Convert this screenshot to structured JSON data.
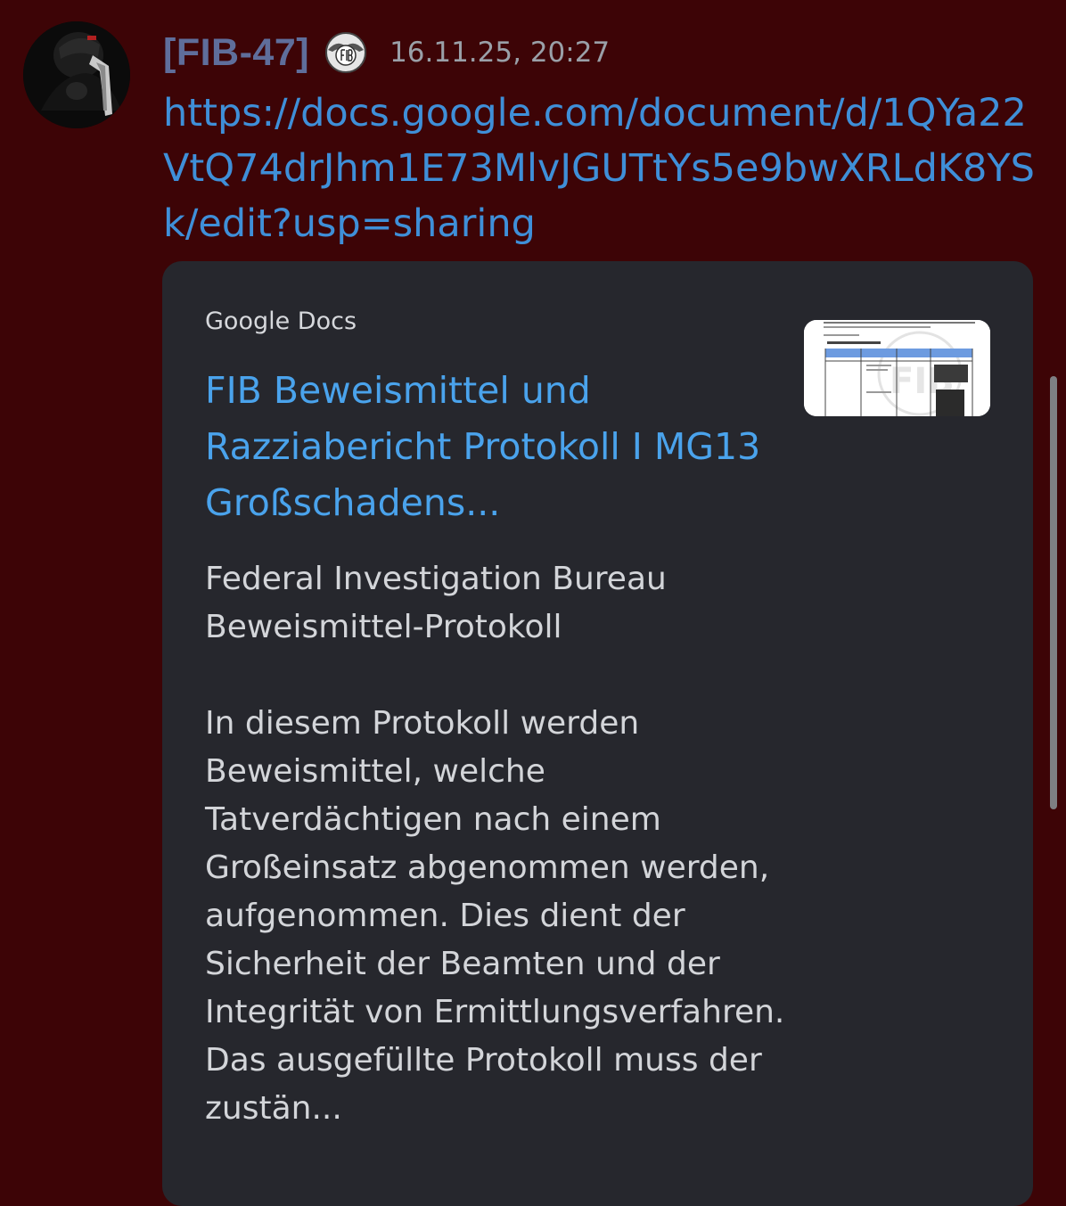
{
  "message": {
    "author": "[FIB-47]",
    "timestamp": "16.11.25, 20:27",
    "link": "https://docs.google.com/document/d/1QYa22VtQ74drJhm1E73MlvJGUTtYs5e9bwXRLdK8YSk/edit?usp=sharing"
  },
  "embed": {
    "provider": "Google Docs",
    "title": "FIB Beweismittel und Razziabericht Protokoll I MG13 Großschadens...",
    "description": "Federal Investigation Bureau\nBeweismittel-Protokoll\n\nIn diesem Protokoll werden Beweismittel, welche Tatverdächtigen nach einem Großeinsatz abgenommen werden, aufgenommen. Dies dient der Sicherheit der Beamten und der Integrität von Ermittlungsverfahren. Das ausgefüllte Protokoll muss der zustän...",
    "thumbnail_logo_text": "FIB"
  },
  "icons": {
    "avatar": "user-avatar",
    "badge": "fib-emblem-icon"
  },
  "colors": {
    "background": "#3d0406",
    "username": "#5f6e9b",
    "link": "#3f8fd8",
    "embed_background": "#26272d",
    "embed_title": "#4aa3ec"
  }
}
